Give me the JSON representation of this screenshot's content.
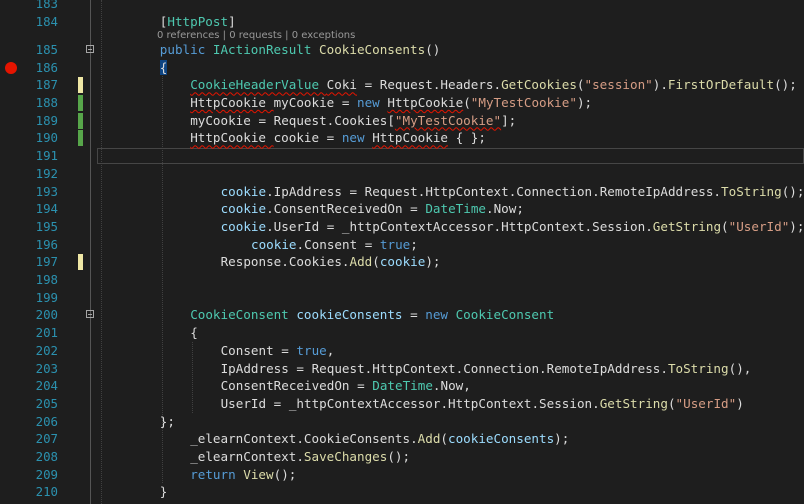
{
  "editor": {
    "codelens": {
      "references": "0 references",
      "sep1": " | ",
      "requests": "0 requests",
      "sep2": " | ",
      "exceptions": "0 exceptions"
    },
    "lines": [
      {
        "num": "183",
        "tokens": []
      },
      {
        "num": "184",
        "indent": 8,
        "tokens": [
          {
            "t": "[",
            "c": "pl"
          },
          {
            "t": "HttpPost",
            "c": "ty"
          },
          {
            "t": "]",
            "c": "pl"
          }
        ]
      },
      {
        "num": "185",
        "indent": 8,
        "tokens": [
          {
            "t": "public ",
            "c": "kw"
          },
          {
            "t": "IActionResult ",
            "c": "ty"
          },
          {
            "t": "CookieConsents",
            "c": "me"
          },
          {
            "t": "()",
            "c": "pl"
          }
        ]
      },
      {
        "num": "186",
        "indent": 8,
        "tokens": [
          {
            "t": "{",
            "c": "pl braceHL"
          }
        ]
      },
      {
        "num": "187",
        "indent": 12,
        "tokens": [
          {
            "t": "CookieHeaderValue ",
            "c": "ty squig"
          },
          {
            "t": "Coki",
            "c": "pl squig"
          },
          {
            "t": " = Request.Headers.",
            "c": "pl"
          },
          {
            "t": "GetCookies",
            "c": "me"
          },
          {
            "t": "(",
            "c": "pl"
          },
          {
            "t": "\"session\"",
            "c": "str"
          },
          {
            "t": ").",
            "c": "pl"
          },
          {
            "t": "FirstOrDefault",
            "c": "me"
          },
          {
            "t": "();",
            "c": "pl"
          }
        ]
      },
      {
        "num": "188",
        "indent": 12,
        "tokens": [
          {
            "t": "HttpCookie ",
            "c": "pl squig"
          },
          {
            "t": "myCookie",
            "c": "pl"
          },
          {
            "t": " = ",
            "c": "pl"
          },
          {
            "t": "new ",
            "c": "kw"
          },
          {
            "t": "HttpCookie",
            "c": "pl squig"
          },
          {
            "t": "(",
            "c": "pl"
          },
          {
            "t": "\"MyTestCookie\"",
            "c": "str"
          },
          {
            "t": ");",
            "c": "pl"
          }
        ]
      },
      {
        "num": "189",
        "indent": 12,
        "tokens": [
          {
            "t": "myCookie",
            "c": "pl"
          },
          {
            "t": " = Request.Cookies[",
            "c": "pl"
          },
          {
            "t": "\"MyTestCookie\"",
            "c": "str squig"
          },
          {
            "t": "];",
            "c": "pl"
          }
        ]
      },
      {
        "num": "190",
        "indent": 12,
        "tokens": [
          {
            "t": "HttpCookie ",
            "c": "pl squig"
          },
          {
            "t": "cookie",
            "c": "pl"
          },
          {
            "t": " = ",
            "c": "pl"
          },
          {
            "t": "new ",
            "c": "kw"
          },
          {
            "t": "HttpCookie",
            "c": "pl squig"
          },
          {
            "t": " { };",
            "c": "pl"
          }
        ]
      },
      {
        "num": "191",
        "tokens": []
      },
      {
        "num": "192",
        "tokens": []
      },
      {
        "num": "193",
        "indent": 16,
        "tokens": [
          {
            "t": "cookie",
            "c": "id"
          },
          {
            "t": ".IpAddress = Request.HttpContext.Connection.RemoteIpAddress.",
            "c": "pl"
          },
          {
            "t": "ToString",
            "c": "me"
          },
          {
            "t": "();",
            "c": "pl"
          }
        ]
      },
      {
        "num": "194",
        "indent": 16,
        "tokens": [
          {
            "t": "cookie",
            "c": "id"
          },
          {
            "t": ".ConsentReceivedOn = ",
            "c": "pl"
          },
          {
            "t": "DateTime",
            "c": "ty"
          },
          {
            "t": ".Now;",
            "c": "pl"
          }
        ]
      },
      {
        "num": "195",
        "indent": 16,
        "tokens": [
          {
            "t": "cookie",
            "c": "id"
          },
          {
            "t": ".UserId = _httpContextAccessor.HttpContext.Session.",
            "c": "pl"
          },
          {
            "t": "GetString",
            "c": "me"
          },
          {
            "t": "(",
            "c": "pl"
          },
          {
            "t": "\"UserId\"",
            "c": "str"
          },
          {
            "t": ");",
            "c": "pl"
          }
        ]
      },
      {
        "num": "196",
        "indent": 20,
        "tokens": [
          {
            "t": "cookie",
            "c": "id"
          },
          {
            "t": ".Consent = ",
            "c": "pl"
          },
          {
            "t": "true",
            "c": "kw"
          },
          {
            "t": ";",
            "c": "pl"
          }
        ]
      },
      {
        "num": "197",
        "indent": 16,
        "tokens": [
          {
            "t": "Response.Cookies.",
            "c": "pl"
          },
          {
            "t": "Add",
            "c": "me"
          },
          {
            "t": "(",
            "c": "pl"
          },
          {
            "t": "cookie",
            "c": "id"
          },
          {
            "t": ");",
            "c": "pl"
          }
        ]
      },
      {
        "num": "198",
        "tokens": []
      },
      {
        "num": "199",
        "tokens": []
      },
      {
        "num": "200",
        "indent": 12,
        "tokens": [
          {
            "t": "CookieConsent ",
            "c": "ty"
          },
          {
            "t": "cookieConsents",
            "c": "id"
          },
          {
            "t": " = ",
            "c": "pl"
          },
          {
            "t": "new ",
            "c": "kw"
          },
          {
            "t": "CookieConsent",
            "c": "ty"
          }
        ]
      },
      {
        "num": "201",
        "indent": 12,
        "tokens": [
          {
            "t": "{",
            "c": "pl"
          }
        ]
      },
      {
        "num": "202",
        "indent": 16,
        "tokens": [
          {
            "t": "Consent = ",
            "c": "pl"
          },
          {
            "t": "true",
            "c": "kw"
          },
          {
            "t": ",",
            "c": "pl"
          }
        ]
      },
      {
        "num": "203",
        "indent": 16,
        "tokens": [
          {
            "t": "IpAddress = Request.HttpContext.Connection.RemoteIpAddress.",
            "c": "pl"
          },
          {
            "t": "ToString",
            "c": "me"
          },
          {
            "t": "(),",
            "c": "pl"
          }
        ]
      },
      {
        "num": "204",
        "indent": 16,
        "tokens": [
          {
            "t": "ConsentReceivedOn = ",
            "c": "pl"
          },
          {
            "t": "DateTime",
            "c": "ty"
          },
          {
            "t": ".Now,",
            "c": "pl"
          }
        ]
      },
      {
        "num": "205",
        "indent": 16,
        "tokens": [
          {
            "t": "UserId = _httpContextAccessor.HttpContext.Session.",
            "c": "pl"
          },
          {
            "t": "GetString",
            "c": "me"
          },
          {
            "t": "(",
            "c": "pl"
          },
          {
            "t": "\"UserId\"",
            "c": "str"
          },
          {
            "t": ")",
            "c": "pl"
          }
        ]
      },
      {
        "num": "206",
        "indent": 8,
        "tokens": [
          {
            "t": "};",
            "c": "pl"
          }
        ]
      },
      {
        "num": "207",
        "indent": 12,
        "tokens": [
          {
            "t": "_elearnContext.CookieConsents.",
            "c": "pl"
          },
          {
            "t": "Add",
            "c": "me"
          },
          {
            "t": "(",
            "c": "pl"
          },
          {
            "t": "cookieConsents",
            "c": "id"
          },
          {
            "t": ");",
            "c": "pl"
          }
        ]
      },
      {
        "num": "208",
        "indent": 12,
        "tokens": [
          {
            "t": "_elearnContext.",
            "c": "pl"
          },
          {
            "t": "SaveChanges",
            "c": "me"
          },
          {
            "t": "();",
            "c": "pl"
          }
        ]
      },
      {
        "num": "209",
        "indent": 12,
        "tokens": [
          {
            "t": "return ",
            "c": "kw"
          },
          {
            "t": "View",
            "c": "me"
          },
          {
            "t": "();",
            "c": "pl"
          }
        ]
      },
      {
        "num": "210",
        "indent": 8,
        "tokens": [
          {
            "t": "}",
            "c": "pl"
          }
        ]
      }
    ],
    "breakpoint_line": "186",
    "change_markers": {
      "187": "unsaved",
      "188": "saved",
      "189": "saved",
      "190": "saved",
      "197": "unsaved"
    },
    "fold_lines": [
      "185",
      "200"
    ],
    "current_line": "191"
  }
}
